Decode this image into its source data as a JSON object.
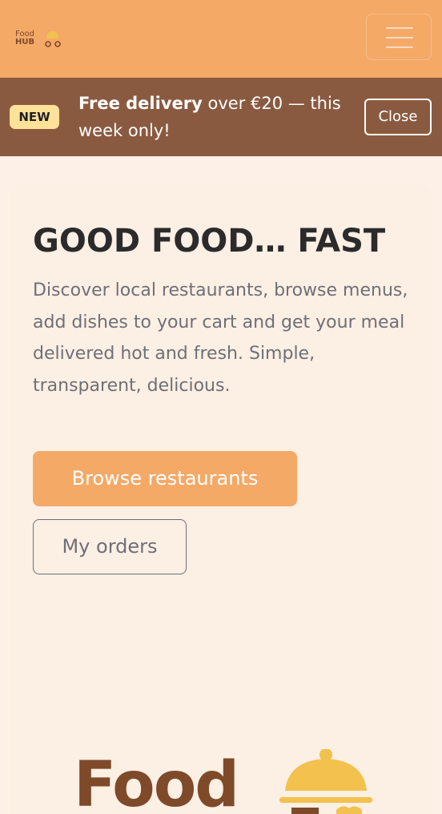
{
  "header": {
    "logo_line1": "Food",
    "logo_line2": "HUB",
    "menu_icon": "hamburger-icon"
  },
  "announcement": {
    "badge": "NEW",
    "bold_text": "Free delivery",
    "text": " over €20 — this week only!",
    "close_label": "Close"
  },
  "hero": {
    "title": "GOOD FOOD… FAST",
    "description": "Discover local restaurants, browse menus, add dishes to your cart and get your meal delivered hot and fresh. Simple, transparent, delicious.",
    "primary_button": "Browse restaurants",
    "secondary_button": "My orders"
  },
  "illustration": {
    "word": "Food",
    "icon": "cloche-icon"
  },
  "colors": {
    "header_bg": "#f4a967",
    "announcement_bg": "#8a5a40",
    "badge_bg": "#ffe29a",
    "page_bg": "#fdf1e7",
    "text_muted": "#6e7077",
    "brand_brown": "#7e4a2a",
    "cloche_yellow": "#f2c14e"
  }
}
